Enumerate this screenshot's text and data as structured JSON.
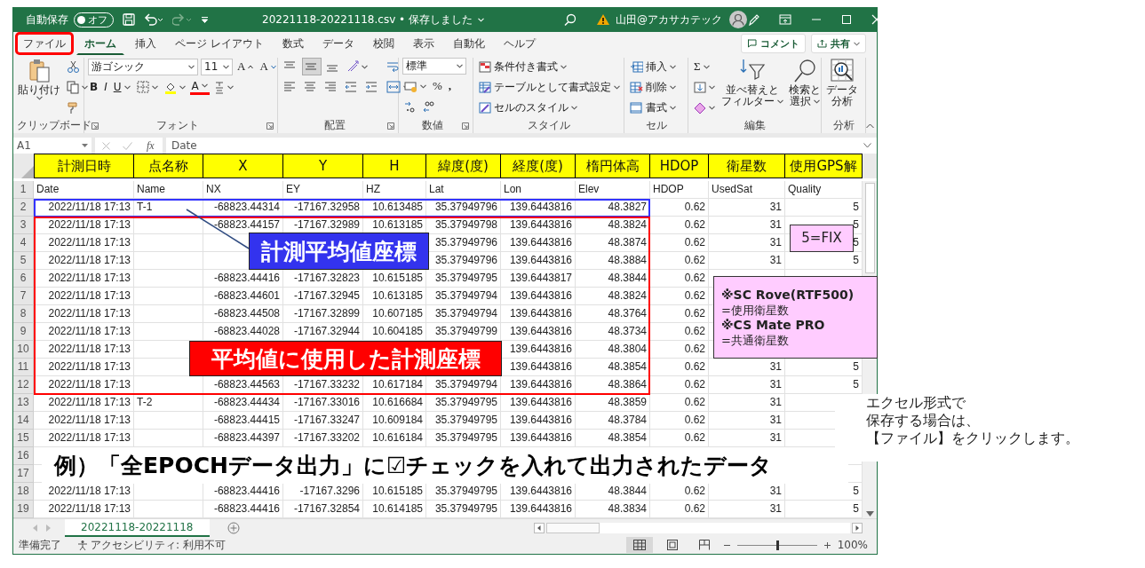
{
  "title_bar": {
    "autosave_label": "自動保存",
    "autosave_toggle": {
      "label": "オフ",
      "on": false
    },
    "document_title": "20221118-20221118.csv • 保存しました",
    "user_name": "山田@アカサカテック"
  },
  "ribbon_tabs": [
    {
      "label": "ファイル",
      "selected": false,
      "callout": true
    },
    {
      "label": "ホーム",
      "selected": true,
      "callout": false
    },
    {
      "label": "挿入",
      "selected": false,
      "callout": false
    },
    {
      "label": "ページ レイアウト",
      "selected": false,
      "callout": false
    },
    {
      "label": "数式",
      "selected": false,
      "callout": false
    },
    {
      "label": "データ",
      "selected": false,
      "callout": false
    },
    {
      "label": "校閲",
      "selected": false,
      "callout": false
    },
    {
      "label": "表示",
      "selected": false,
      "callout": false
    },
    {
      "label": "自動化",
      "selected": false,
      "callout": false
    },
    {
      "label": "ヘルプ",
      "selected": false,
      "callout": false
    }
  ],
  "ribbon_buttons": {
    "comment": "コメント",
    "share": "共有"
  },
  "ribbon": {
    "clipboard": {
      "label": "クリップボード",
      "paste": "貼り付け"
    },
    "font": {
      "label": "フォント",
      "font_name": "游ゴシック",
      "font_size": "11",
      "grow": "A",
      "shrink": "A",
      "bold": "B",
      "italic": "I",
      "underline": "U",
      "font_color": "A"
    },
    "alignment": {
      "label": "配置"
    },
    "number": {
      "label": "数値",
      "format": "標準",
      "percent": "%",
      "comma": ","
    },
    "styles": {
      "label": "スタイル",
      "items": [
        "条件付き書式",
        "テーブルとして書式設定",
        "セルのスタイル"
      ]
    },
    "cells": {
      "label": "セル",
      "items": [
        "挿入",
        "削除",
        "書式"
      ]
    },
    "editing": {
      "label": "編集",
      "sum": "Σ",
      "sort": [
        "並べ替えと",
        "フィルター"
      ],
      "find": [
        "検索と",
        "選択"
      ]
    },
    "analysis": {
      "label": "分析",
      "button": [
        "データ",
        "分析"
      ]
    }
  },
  "formula_bar": {
    "name_box": "A1",
    "fx": "fx",
    "content": "Date"
  },
  "header_overlay": [
    "計測日時",
    "点名称",
    "X",
    "Y",
    "H",
    "緯度(度)",
    "経度(度)",
    "楕円体高",
    "HDOP",
    "衛星数",
    "使用GPS解"
  ],
  "rows": [
    {
      "number": "1",
      "kind": "labels",
      "cells": {
        "date": "Date",
        "name": "Name",
        "nx": "NX",
        "ey": "EY",
        "hz": "HZ",
        "lat": "Lat",
        "lon": "Lon",
        "elev": "Elev",
        "hdop": "HDOP",
        "used_sat": "UsedSat",
        "quality": "Quality"
      }
    },
    {
      "number": "2",
      "kind": "values",
      "cells": {
        "date": "2022/11/18 17:13",
        "name": "T-1",
        "nx": "-68823.44314",
        "ey": "-17167.32958",
        "hz": "10.613485",
        "lat": "35.37949796",
        "lon": "139.6443816",
        "elev": "48.3827",
        "hdop": "0.62",
        "used_sat": "31",
        "quality": "5"
      }
    },
    {
      "number": "3",
      "kind": "values",
      "cells": {
        "date": "2022/11/18 17:13",
        "nx": "-68823.44157",
        "ey": "-17167.32989",
        "hz": "10.613185",
        "lat": "35.37949798",
        "lon": "139.6443816",
        "elev": "48.3824",
        "hdop": "0.62",
        "used_sat": "31",
        "quality": "5"
      }
    },
    {
      "number": "4",
      "kind": "values",
      "cells": {
        "date": "2022/11/18 17:13",
        "lat": "35.37949796",
        "lon": "139.6443816",
        "elev": "48.3874",
        "hdop": "0.62",
        "used_sat": "31",
        "quality": "5"
      }
    },
    {
      "number": "5",
      "kind": "values",
      "cells": {
        "date": "2022/11/18 17:13",
        "lat": "35.37949796",
        "lon": "139.6443816",
        "elev": "48.3884",
        "hdop": "0.62",
        "used_sat": "31",
        "quality": "5"
      }
    },
    {
      "number": "6",
      "kind": "values",
      "cells": {
        "date": "2022/11/18 17:13",
        "nx": "-68823.44416",
        "ey": "-17167.32823",
        "hz": "10.615185",
        "lat": "35.37949795",
        "lon": "139.6443817",
        "elev": "48.3844",
        "hdop": "0.62"
      }
    },
    {
      "number": "7",
      "kind": "values",
      "cells": {
        "date": "2022/11/18 17:13",
        "nx": "-68823.44601",
        "ey": "-17167.32945",
        "hz": "10.613185",
        "lat": "35.37949794",
        "lon": "139.6443816",
        "elev": "48.3824",
        "hdop": "0.62"
      }
    },
    {
      "number": "8",
      "kind": "values",
      "cells": {
        "date": "2022/11/18 17:13",
        "nx": "-68823.44508",
        "ey": "-17167.32899",
        "hz": "10.607185",
        "lat": "35.37949794",
        "lon": "139.6443816",
        "elev": "48.3764",
        "hdop": "0.62"
      }
    },
    {
      "number": "9",
      "kind": "values",
      "cells": {
        "date": "2022/11/18 17:13",
        "nx": "-68823.44028",
        "ey": "-17167.32944",
        "hz": "10.604185",
        "lat": "35.37949799",
        "lon": "139.6443816",
        "elev": "48.3734",
        "hdop": "0.62"
      }
    },
    {
      "number": "10",
      "kind": "values",
      "cells": {
        "date": "2022/11/18 17:13",
        "lon": "139.6443816",
        "elev": "48.3804",
        "hdop": "0.62"
      }
    },
    {
      "number": "11",
      "kind": "values",
      "cells": {
        "date": "2022/11/18 17:13",
        "lon": "139.6443816",
        "elev": "48.3854",
        "hdop": "0.62",
        "used_sat": "31",
        "quality": "5"
      }
    },
    {
      "number": "12",
      "kind": "values",
      "cells": {
        "date": "2022/11/18 17:13",
        "nx": "-68823.44563",
        "ey": "-17167.33232",
        "hz": "10.617184",
        "lat": "35.37949794",
        "lon": "139.6443816",
        "elev": "48.3864",
        "hdop": "0.62",
        "used_sat": "31",
        "quality": "5"
      }
    },
    {
      "number": "13",
      "kind": "values",
      "cells": {
        "date": "2022/11/18 17:13",
        "name": "T-2",
        "nx": "-68823.44434",
        "ey": "-17167.33016",
        "hz": "10.616684",
        "lat": "35.37949795",
        "lon": "139.6443816",
        "elev": "48.3859",
        "hdop": "0.62",
        "used_sat": "31"
      }
    },
    {
      "number": "14",
      "kind": "values",
      "cells": {
        "date": "2022/11/18 17:13",
        "nx": "-68823.44415",
        "ey": "-17167.33247",
        "hz": "10.609184",
        "lat": "35.37949795",
        "lon": "139.6443816",
        "elev": "48.3784",
        "hdop": "0.62",
        "used_sat": "31"
      }
    },
    {
      "number": "15",
      "kind": "values",
      "cells": {
        "date": "2022/11/18 17:13",
        "nx": "-68823.44397",
        "ey": "-17167.33202",
        "hz": "10.616184",
        "lat": "35.37949795",
        "lon": "139.6443816",
        "elev": "48.3854",
        "hdop": "0.62",
        "used_sat": "31"
      }
    },
    {
      "number": "16",
      "kind": "values",
      "cells": {}
    },
    {
      "number": "17",
      "kind": "values",
      "cells": {}
    },
    {
      "number": "18",
      "kind": "values",
      "cells": {
        "date": "2022/11/18 17:13",
        "nx": "-68823.44416",
        "ey": "-17167.3296",
        "hz": "10.615185",
        "lat": "35.37949795",
        "lon": "139.6443816",
        "elev": "48.3844",
        "hdop": "0.62",
        "used_sat": "31",
        "quality": "5"
      }
    },
    {
      "number": "19",
      "kind": "values",
      "cells": {
        "date": "2022/11/18 17:13",
        "nx": "-68823.44416",
        "ey": "-17167.32854",
        "hz": "10.614185",
        "lat": "35.37949795",
        "lon": "139.6443816",
        "elev": "48.3834",
        "hdop": "0.62",
        "used_sat": "31",
        "quality": "5"
      }
    }
  ],
  "callouts": [
    {
      "kind": "frame",
      "color": "#3333ff"
    },
    {
      "kind": "frame",
      "color": "#ff0000"
    },
    {
      "kind": "leader"
    },
    {
      "kind": "label",
      "text": "計測平均値座標",
      "color": "#3333ee"
    },
    {
      "kind": "label",
      "text": "平均値に使用した計測座標",
      "color": "#ff0000"
    },
    {
      "kind": "note",
      "lines": [
        {
          "text": "5=FIX",
          "bold": false
        }
      ]
    },
    {
      "kind": "note",
      "lines": [
        {
          "text": "※SC Rove(RTF500)",
          "bold": true
        },
        {
          "text": "=使用衛星数",
          "bold": false
        },
        {
          "text": "※CS Mate PRO",
          "bold": true
        },
        {
          "text": "=共通衛星数",
          "bold": false
        }
      ]
    },
    {
      "kind": "banner",
      "text": "例）「全EPOCHデータ出力」に☑チェックを入れて出力されたデータ"
    }
  ],
  "sheet_tabs": [
    {
      "label": "20221118-20221118",
      "selected": true
    }
  ],
  "status_bar": {
    "ready": "準備完了",
    "accessibility": "アクセシビリティ: 利用不可",
    "zoom_slider": {
      "level": 0.5
    },
    "zoom": "100%"
  },
  "side_note": {
    "lines": [
      "エクセル形式で",
      "保存する場合は、",
      "【ファイル】をクリックします。"
    ]
  }
}
